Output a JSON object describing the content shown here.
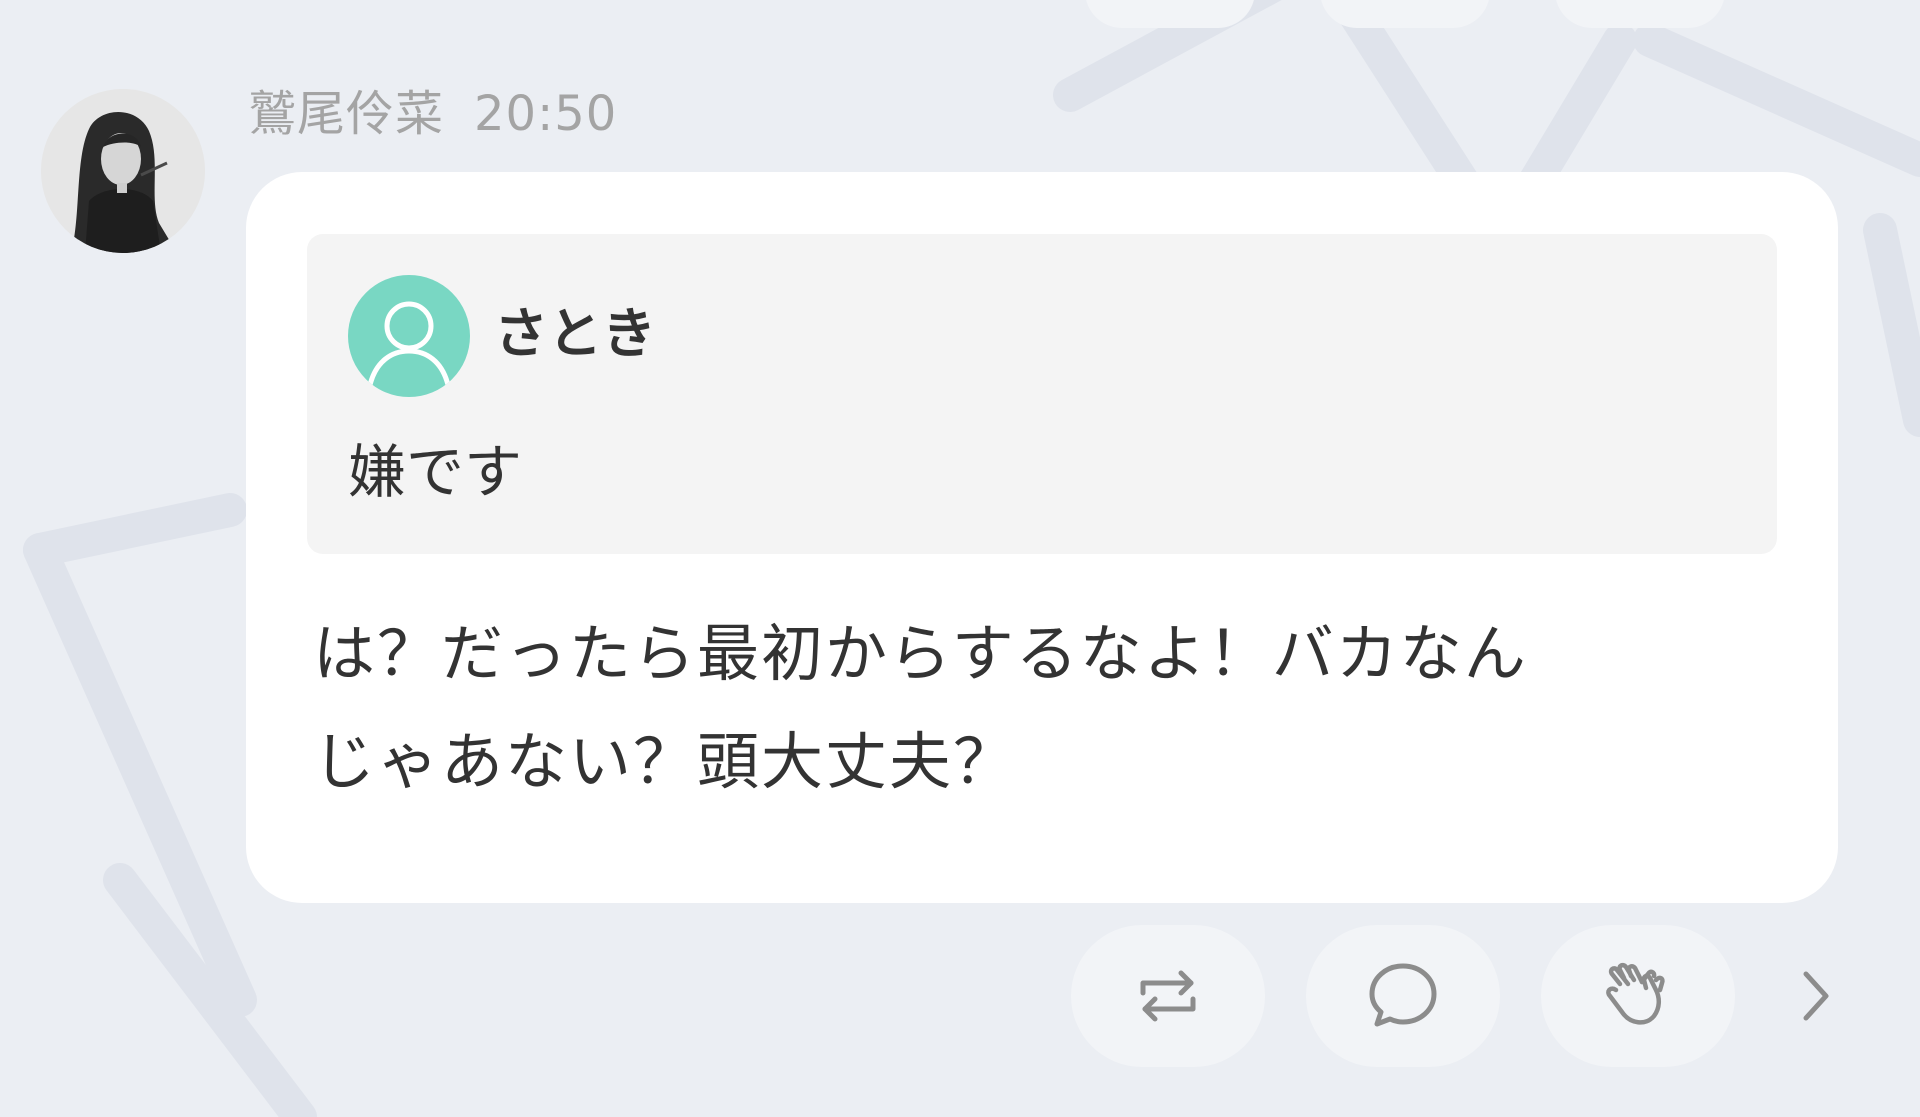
{
  "post": {
    "author_name": "鷲尾伶菜",
    "time": "20:50",
    "quoted": {
      "author_name": "さとき",
      "text": "嫌です"
    },
    "message_line1": "は？だったら最初からするなよ！バカなん",
    "message_line2": "じゃあない？頭大丈夫？"
  },
  "actions": [
    {
      "name": "repost",
      "icon": "repost-icon"
    },
    {
      "name": "reply",
      "icon": "comment-bubble-icon"
    },
    {
      "name": "clap",
      "icon": "clapping-hands-icon"
    },
    {
      "name": "more",
      "icon": "chevron-right-icon"
    }
  ],
  "colors": {
    "background": "#ebeef3",
    "bubble": "#ffffff",
    "quote_background": "#f4f4f4",
    "quote_avatar": "#79d7c3",
    "meta_text": "#a4a4a4",
    "body_text": "#333333",
    "action_pill": "#f2f4f7",
    "icon": "#8c8c8c"
  }
}
